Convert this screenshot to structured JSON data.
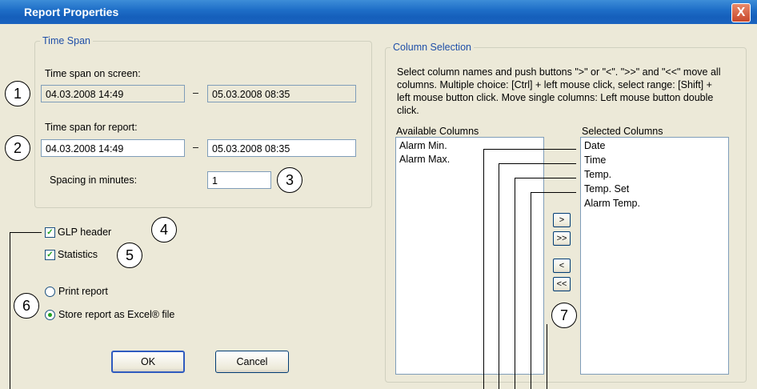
{
  "window": {
    "title": "Report Properties",
    "close_label": "X"
  },
  "time_span": {
    "legend": "Time Span",
    "screen_label": "Time span on screen:",
    "screen_from": "04.03.2008 14:49",
    "screen_to": "05.03.2008 08:35",
    "report_label": "Time span for report:",
    "report_from": "04.03.2008 14:49",
    "report_to": "05.03.2008 08:35",
    "dash": "–",
    "spacing_label": "Spacing in minutes:",
    "spacing_value": "1"
  },
  "options": {
    "glp_header": {
      "label": "GLP header",
      "checked": true
    },
    "statistics": {
      "label": "Statistics",
      "checked": true
    },
    "print_report": {
      "label": "Print report",
      "selected": false
    },
    "store_excel": {
      "label": "Store report as Excel® file",
      "selected": true
    }
  },
  "buttons": {
    "ok": "OK",
    "cancel": "Cancel"
  },
  "column_selection": {
    "legend": "Column Selection",
    "description": "Select column names and push buttons \">\" or \"<\". \">>\" and \"<<\" move all columns. Multiple choice: [Ctrl] + left mouse click, select range: [Shift] + left mouse button click. Move single columns: Left mouse button double click.",
    "available_label": "Available Columns",
    "available": [
      "Alarm Min.",
      "Alarm Max."
    ],
    "selected_label": "Selected Columns",
    "selected": [
      "Date",
      "Time",
      "Temp.",
      "Temp. Set",
      "Alarm Temp."
    ],
    "move_buttons": [
      ">",
      ">>",
      "<",
      "<<"
    ]
  },
  "callouts": [
    "1",
    "2",
    "3",
    "4",
    "5",
    "6",
    "7"
  ]
}
